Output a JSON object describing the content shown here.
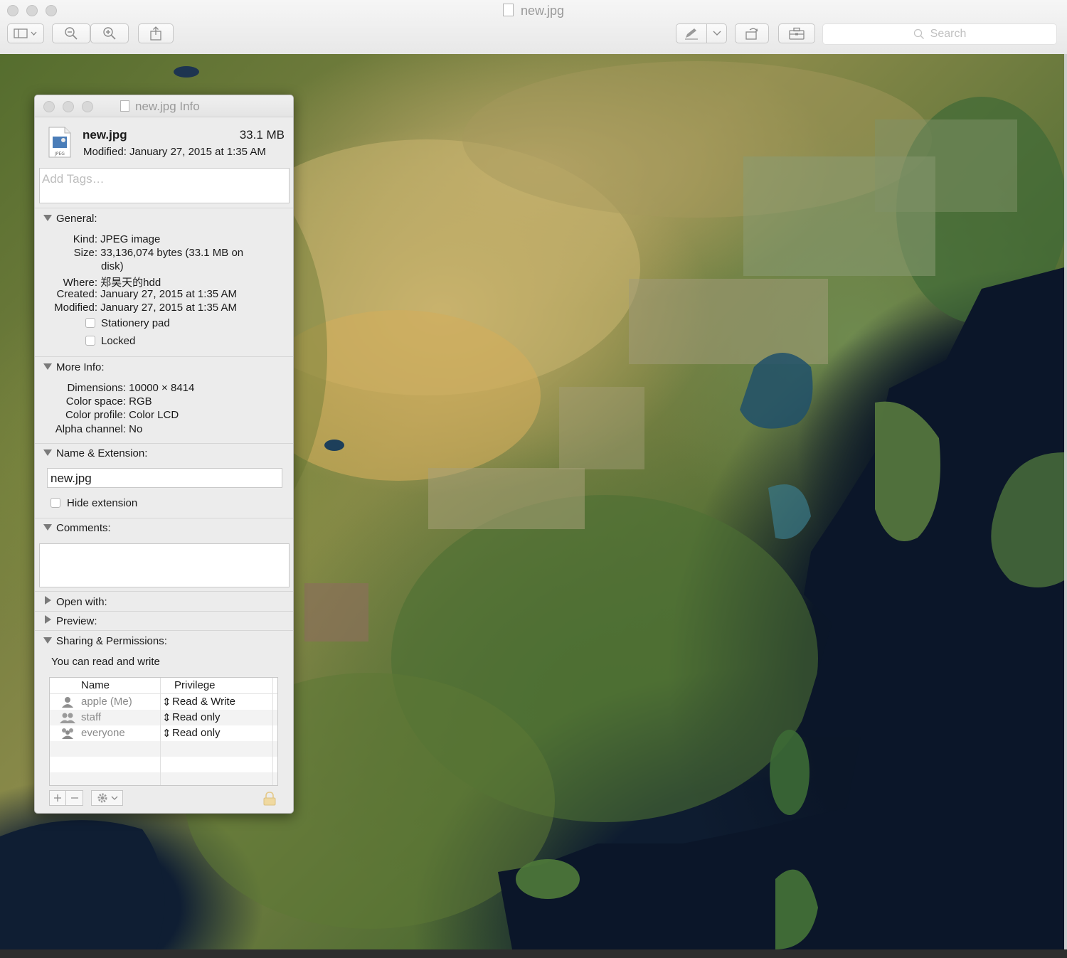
{
  "window": {
    "title": "new.jpg"
  },
  "toolbar": {
    "search_placeholder": "Search",
    "buttons": [
      "sidebar-toggle",
      "zoom-out",
      "zoom-in",
      "share",
      "markup",
      "markup-menu",
      "rotate",
      "toolbox"
    ]
  },
  "colors": {
    "panel_bg": "#ececec",
    "window_chrome": "#f0f0f0",
    "text": "#1a1a1a",
    "muted_text": "#9a9a9a"
  },
  "info": {
    "title": "new.jpg Info",
    "file_name": "new.jpg",
    "file_size": "33.1 MB",
    "modified_line": "Modified: January 27, 2015 at 1:35 AM",
    "tags_placeholder": "Add Tags…",
    "general": {
      "header": "General:",
      "kind_label": "Kind:",
      "kind": "JPEG image",
      "size_label": "Size:",
      "size_line1": "33,136,074 bytes (33.1 MB on",
      "size_line2": "disk)",
      "where_label": "Where:",
      "where": "郑昊天的hdd",
      "created_label": "Created:",
      "created": "January 27, 2015 at 1:35 AM",
      "modified_label": "Modified:",
      "modified": "January 27, 2015 at 1:35 AM",
      "stationery": "Stationery pad",
      "locked": "Locked"
    },
    "more_info": {
      "header": "More Info:",
      "dimensions_label": "Dimensions:",
      "dimensions": "10000 × 8414",
      "color_space_label": "Color space:",
      "color_space": "RGB",
      "color_profile_label": "Color profile:",
      "color_profile": "Color LCD",
      "alpha_label": "Alpha channel:",
      "alpha": "No"
    },
    "name_ext": {
      "header": "Name & Extension:",
      "value": "new.jpg",
      "hide_extension": "Hide extension"
    },
    "comments": {
      "header": "Comments:"
    },
    "open_with": "Open with:",
    "preview": "Preview:",
    "sharing": {
      "header": "Sharing & Permissions:",
      "summary": "You can read and write",
      "col_name": "Name",
      "col_privilege": "Privilege",
      "rows": [
        {
          "name": "apple (Me)",
          "privilege": "Read & Write"
        },
        {
          "name": "staff",
          "privilege": "Read only"
        },
        {
          "name": "everyone",
          "privilege": "Read only"
        }
      ]
    }
  }
}
